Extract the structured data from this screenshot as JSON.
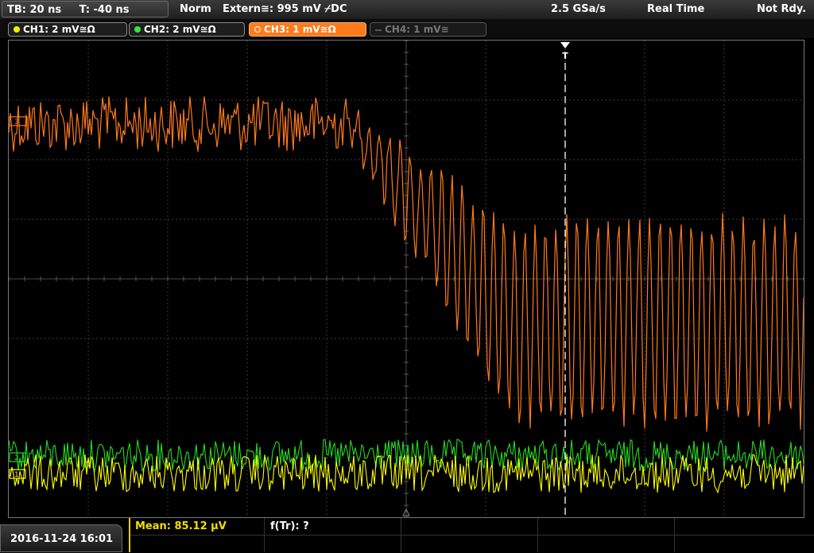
{
  "topbar": {
    "tb": "TB: 20 ns",
    "trig_pos": "T: -40 ns",
    "mode": "Norm",
    "trigger": "Extern≅: 995 mV ⌿DC",
    "sample_rate": "2.5 GSa/s",
    "acq_mode": "Real Time",
    "status": "Not Rdy."
  },
  "channels": [
    {
      "label": "CH1: 2 mV≅Ω",
      "color": "#f0f000",
      "active": true
    },
    {
      "label": "CH2: 2 mV≅Ω",
      "color": "#33e833",
      "active": true
    },
    {
      "label": "CH3: 1 mV≅Ω",
      "color": "#ff7a1a",
      "active": true,
      "selected": true
    },
    {
      "label": "CH4: 1 mV≅",
      "color": "#777777",
      "active": false
    }
  ],
  "plot": {
    "trigger_marker": "T",
    "ch3_marker": "3",
    "ch1_marker": "1",
    "ch2_marker": "2",
    "colors": {
      "ch1": "#ffff00",
      "ch2": "#22dd22",
      "ch3": "#ff7a1a",
      "grid": "#3c3c3c",
      "trigger": "#ffffff"
    }
  },
  "status": {
    "datetime": "2016-11-24 16:01",
    "mean": "Mean: 85.12 µV",
    "ftr": "f(Tr): ?"
  }
}
